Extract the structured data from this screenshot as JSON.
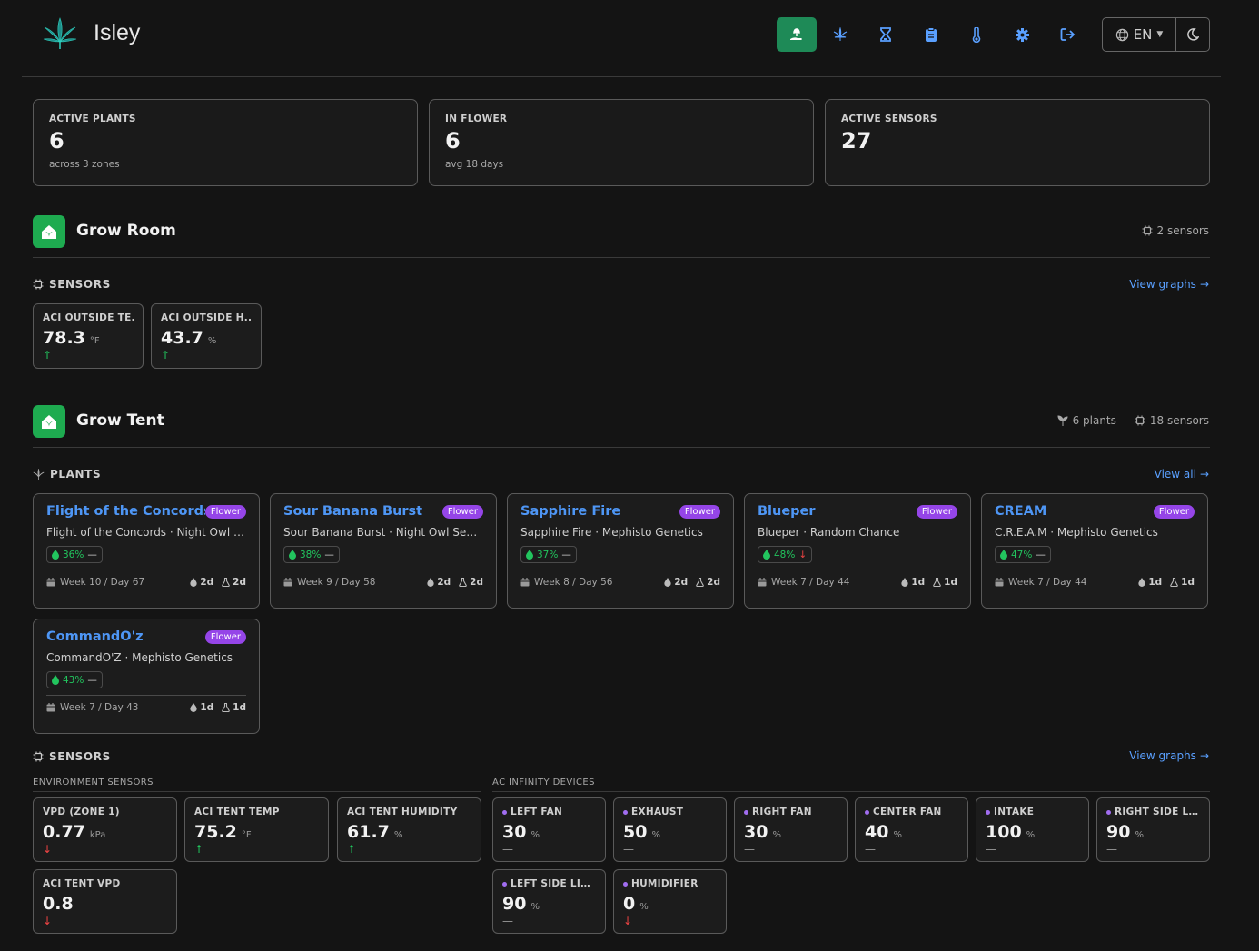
{
  "app": {
    "brand": "Isley",
    "lang": "EN"
  },
  "nav": [
    "seedling-icon",
    "cannabis-leaf-icon",
    "hourglass-icon",
    "clipboard-icon",
    "thermometer-icon",
    "gear-icon",
    "sign-out-icon"
  ],
  "colors": {
    "background": "#141414",
    "accent_green": "#1e8a57",
    "zone_green": "#1eab50",
    "link_blue": "#5aa0ff",
    "plant_blue": "#4e96f5",
    "flower_purple": "#9545e8",
    "up_green": "#22c55e",
    "down_red": "#ef4444"
  },
  "stats": [
    {
      "label": "ACTIVE PLANTS",
      "value": "6",
      "sub": "across 3 zones"
    },
    {
      "label": "IN FLOWER",
      "value": "6",
      "sub": "avg 18 days"
    },
    {
      "label": "ACTIVE SENSORS",
      "value": "27",
      "sub": ""
    }
  ],
  "grow_room": {
    "title": "Grow Room",
    "sensors_meta": "2 sensors",
    "sensors_label": "SENSORS",
    "view_graphs": "View graphs",
    "sensors": [
      {
        "name": "ACI OUTSIDE TE...",
        "value": "78.3",
        "unit": "°F",
        "trend": "↑"
      },
      {
        "name": "ACI OUTSIDE H...",
        "value": "43.7",
        "unit": "%",
        "trend": "↑"
      }
    ]
  },
  "grow_tent": {
    "title": "Grow Tent",
    "plants_meta": "6 plants",
    "sensors_meta": "18 sensors",
    "plants_label": "PLANTS",
    "view_all": "View all",
    "plants": [
      {
        "name": "Flight of the Concords",
        "badge": "Flower",
        "strain": "Flight of the Concords · Night Owl Se...",
        "moisture": "36%",
        "moisture_trend": "—",
        "week": "Week 10 / Day 67",
        "water": "2d",
        "feed": "2d"
      },
      {
        "name": "Sour Banana Burst",
        "badge": "Flower",
        "strain": "Sour Banana Burst · Night Owl Seeds",
        "moisture": "38%",
        "moisture_trend": "—",
        "week": "Week 9 / Day 58",
        "water": "2d",
        "feed": "2d"
      },
      {
        "name": "Sapphire Fire",
        "badge": "Flower",
        "strain": "Sapphire Fire · Mephisto Genetics",
        "moisture": "37%",
        "moisture_trend": "—",
        "week": "Week 8 / Day 56",
        "water": "2d",
        "feed": "2d"
      },
      {
        "name": "Blueper",
        "badge": "Flower",
        "strain": "Blueper · Random Chance",
        "moisture": "48%",
        "moisture_trend": "↓",
        "week": "Week 7 / Day 44",
        "water": "1d",
        "feed": "1d"
      },
      {
        "name": "CREAM",
        "badge": "Flower",
        "strain": "C.R.E.A.M · Mephisto Genetics",
        "moisture": "47%",
        "moisture_trend": "—",
        "week": "Week 7 / Day 44",
        "water": "1d",
        "feed": "1d"
      },
      {
        "name": "CommandO'z",
        "badge": "Flower",
        "strain": "CommandO'Z · Mephisto Genetics",
        "moisture": "43%",
        "moisture_trend": "—",
        "week": "Week 7 / Day 43",
        "water": "1d",
        "feed": "1d"
      }
    ],
    "sensors_label": "SENSORS",
    "view_graphs": "View graphs",
    "env_label": "ENVIRONMENT SENSORS",
    "env_sensors": [
      {
        "name": "VPD (ZONE 1)",
        "value": "0.77",
        "unit": "kPa",
        "trend": "↓"
      },
      {
        "name": "ACI TENT TEMP",
        "value": "75.2",
        "unit": "°F",
        "trend": "↑"
      },
      {
        "name": "ACI TENT HUMIDITY",
        "value": "61.7",
        "unit": "%",
        "trend": "↑"
      },
      {
        "name": "ACI TENT VPD",
        "value": "0.8",
        "unit": "",
        "trend": "↓"
      }
    ],
    "aci_label": "AC INFINITY DEVICES",
    "aci_devices": [
      {
        "name": "LEFT FAN",
        "value": "30",
        "unit": "%",
        "trend": "—"
      },
      {
        "name": "EXHAUST",
        "value": "50",
        "unit": "%",
        "trend": "—"
      },
      {
        "name": "RIGHT FAN",
        "value": "30",
        "unit": "%",
        "trend": "—"
      },
      {
        "name": "CENTER FAN",
        "value": "40",
        "unit": "%",
        "trend": "—"
      },
      {
        "name": "INTAKE",
        "value": "100",
        "unit": "%",
        "trend": "—"
      },
      {
        "name": "RIGHT SIDE LI...",
        "value": "90",
        "unit": "%",
        "trend": "—"
      },
      {
        "name": "LEFT SIDE LIGHT",
        "value": "90",
        "unit": "%",
        "trend": "—"
      },
      {
        "name": "HUMIDIFIER",
        "value": "0",
        "unit": "%",
        "trend": "↓"
      }
    ]
  }
}
